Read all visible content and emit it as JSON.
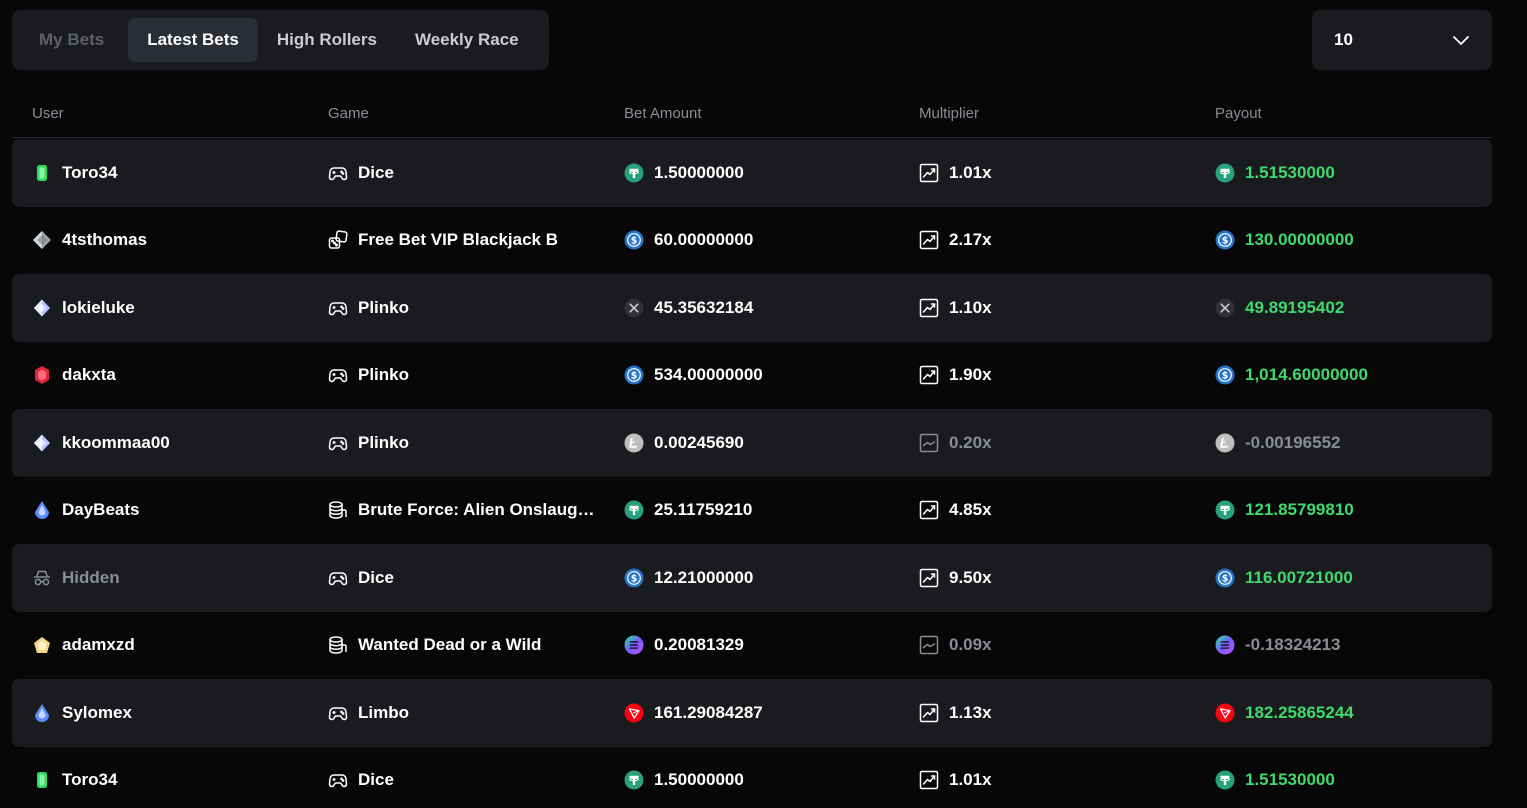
{
  "tabs": [
    {
      "label": "My Bets"
    },
    {
      "label": "Latest Bets"
    },
    {
      "label": "High Rollers"
    },
    {
      "label": "Weekly Race"
    }
  ],
  "active_tab": 1,
  "select": {
    "value": "10"
  },
  "columns": {
    "user": "User",
    "game": "Game",
    "bet": "Bet Amount",
    "mult": "Multiplier",
    "payout": "Payout"
  },
  "rows": [
    {
      "user": "Toro34",
      "rank": "emerald-gem-icon",
      "game": "Dice",
      "game_icon": "gamepad-icon",
      "currency": "usdt-coin-icon",
      "bet": "1.50000000",
      "mult": "1.01x",
      "payout": "1.51530000",
      "win": true
    },
    {
      "user": "4tsthomas",
      "rank": "platinum-gem-icon",
      "game": "Free Bet VIP Blackjack B",
      "game_icon": "dice-cards-icon",
      "currency": "usdc-coin-icon",
      "bet": "60.00000000",
      "mult": "2.17x",
      "payout": "130.00000000",
      "win": true
    },
    {
      "user": "lokieluke",
      "rank": "diamond-gem-icon",
      "game": "Plinko",
      "game_icon": "gamepad-icon",
      "currency": "xrp-coin-icon",
      "bet": "45.35632184",
      "mult": "1.10x",
      "payout": "49.89195402",
      "win": true
    },
    {
      "user": "dakxta",
      "rank": "ruby-gem-icon",
      "game": "Plinko",
      "game_icon": "gamepad-icon",
      "currency": "usdc-coin-icon",
      "bet": "534.00000000",
      "mult": "1.90x",
      "payout": "1,014.60000000",
      "win": true
    },
    {
      "user": "kkoommaa00",
      "rank": "diamond-gem-icon",
      "game": "Plinko",
      "game_icon": "gamepad-icon",
      "currency": "litecoin-icon",
      "bet": "0.00245690",
      "mult": "0.20x",
      "payout": "-0.00196552",
      "win": false
    },
    {
      "user": "DayBeats",
      "rank": "sapphire-drop-icon",
      "game": "Brute Force: Alien Onslaug…",
      "game_icon": "slots-icon",
      "currency": "usdt-coin-icon",
      "bet": "25.11759210",
      "mult": "4.85x",
      "payout": "121.85799810",
      "win": true
    },
    {
      "user": "Hidden",
      "rank": "incognito-icon",
      "game": "Dice",
      "game_icon": "gamepad-icon",
      "currency": "usdc-coin-icon",
      "bet": "12.21000000",
      "mult": "9.50x",
      "payout": "116.00721000",
      "win": true,
      "hidden": true
    },
    {
      "user": "adamxzd",
      "rank": "gold-gem-icon",
      "game": "Wanted Dead or a Wild",
      "game_icon": "slots-icon",
      "currency": "solana-coin-icon",
      "bet": "0.20081329",
      "mult": "0.09x",
      "payout": "-0.18324213",
      "win": false
    },
    {
      "user": "Sylomex",
      "rank": "sapphire-drop-icon",
      "game": "Limbo",
      "game_icon": "gamepad-icon",
      "currency": "tron-coin-icon",
      "bet": "161.29084287",
      "mult": "1.13x",
      "payout": "182.25865244",
      "win": true
    },
    {
      "user": "Toro34",
      "rank": "emerald-gem-icon",
      "game": "Dice",
      "game_icon": "gamepad-icon",
      "currency": "usdt-coin-icon",
      "bet": "1.50000000",
      "mult": "1.01x",
      "payout": "1.51530000",
      "win": true
    }
  ],
  "colors": {
    "background": "#070708",
    "panel": "#1a1b1f",
    "active_tab": "#2c2e35",
    "win": "#3fd96c",
    "loss": "#8a8d95"
  }
}
